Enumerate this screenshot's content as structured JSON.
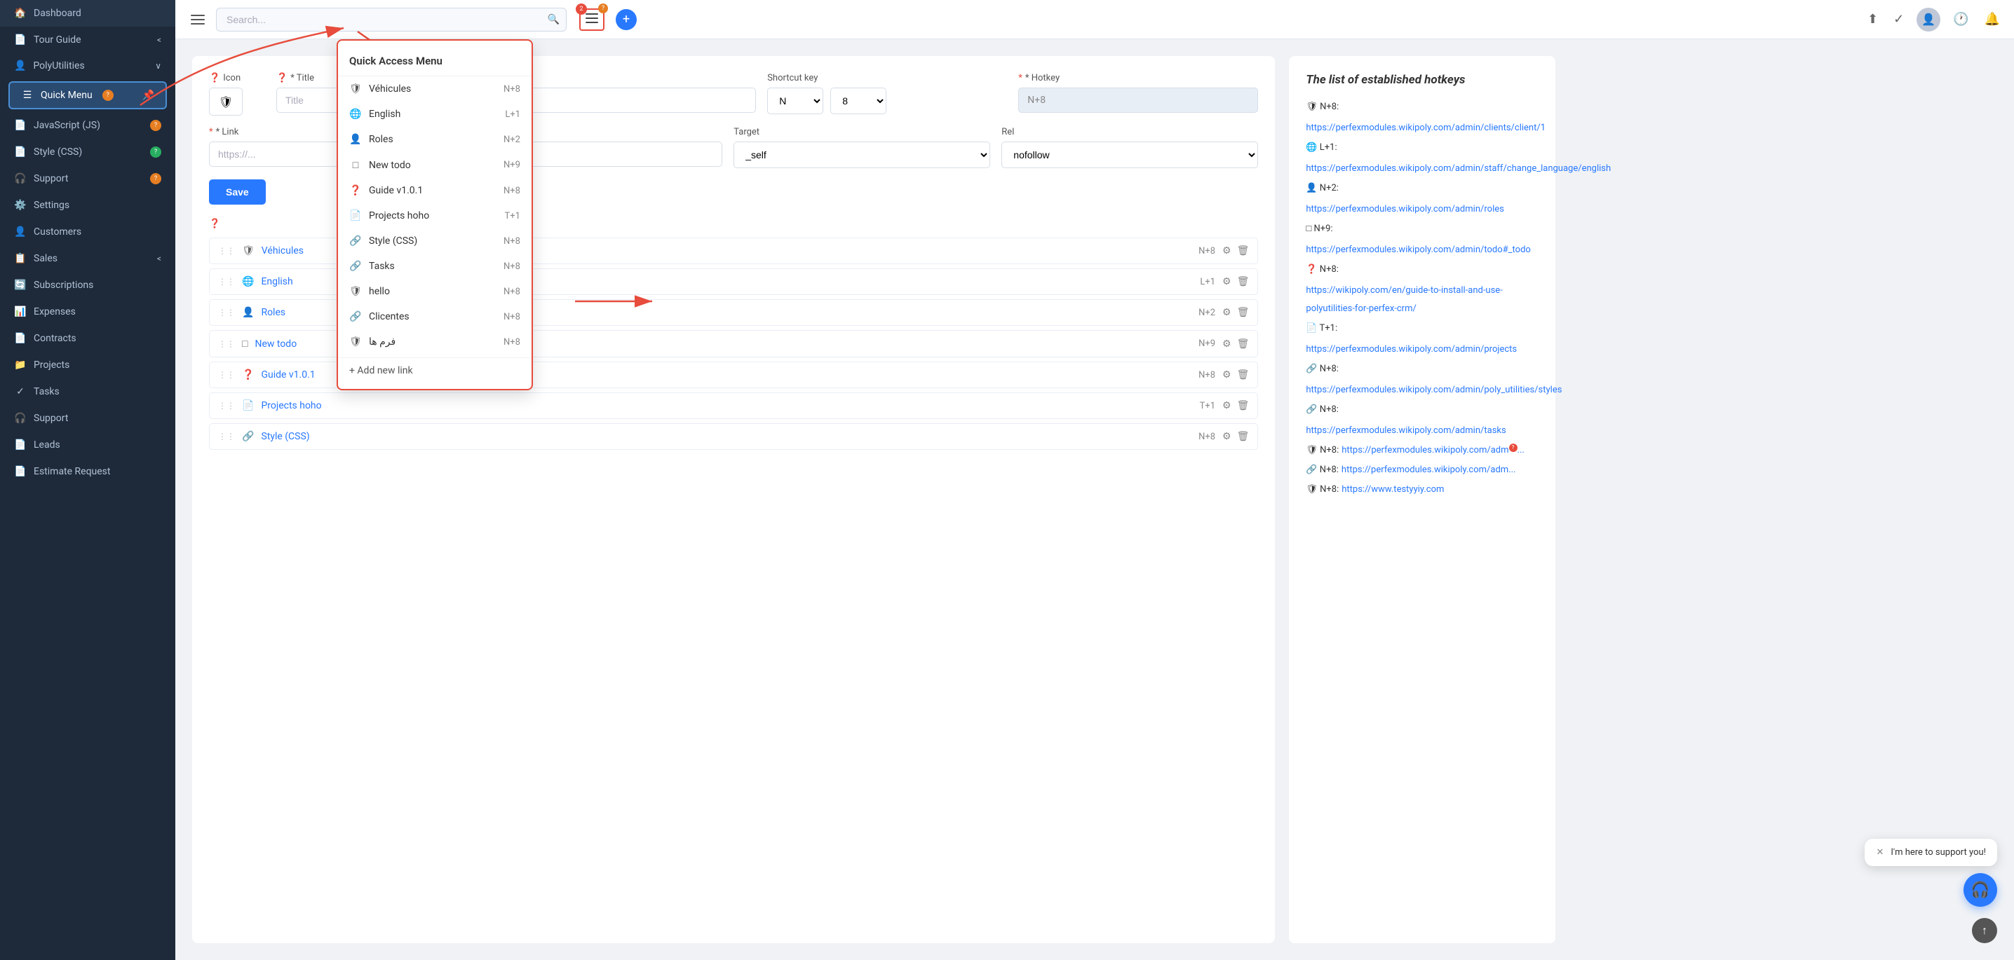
{
  "sidebar": {
    "header": {
      "icon": "🏠",
      "label": "Dashboard"
    },
    "items": [
      {
        "id": "dashboard",
        "icon": "🏠",
        "label": "Dashboard",
        "badge": null
      },
      {
        "id": "tour-guide",
        "icon": "📄",
        "label": "Tour Guide",
        "chevron": "<",
        "badge": null
      },
      {
        "id": "polyutilities",
        "icon": "👤",
        "label": "PolyUtilities",
        "chevron": "∨",
        "badge": null
      },
      {
        "id": "quick-menu",
        "icon": "☰",
        "label": "Quick Menu",
        "active": true,
        "pin": true,
        "helpbadge": true
      },
      {
        "id": "javascript",
        "icon": "📄",
        "label": "JavaScript (JS)",
        "helpbadge": true
      },
      {
        "id": "style-css",
        "icon": "📄",
        "label": "Style (CSS)",
        "helpbadge": true
      },
      {
        "id": "support",
        "icon": "🎧",
        "label": "Support",
        "helpbadge": true
      },
      {
        "id": "settings",
        "icon": "⚙️",
        "label": "Settings"
      },
      {
        "id": "customers",
        "icon": "👤",
        "label": "Customers"
      },
      {
        "id": "sales",
        "icon": "📋",
        "label": "Sales",
        "chevron": "<"
      },
      {
        "id": "subscriptions",
        "icon": "🔄",
        "label": "Subscriptions"
      },
      {
        "id": "expenses",
        "icon": "📊",
        "label": "Expenses"
      },
      {
        "id": "contracts",
        "icon": "📄",
        "label": "Contracts"
      },
      {
        "id": "projects",
        "icon": "📁",
        "label": "Projects"
      },
      {
        "id": "tasks",
        "icon": "✓",
        "label": "Tasks"
      },
      {
        "id": "support2",
        "icon": "🎧",
        "label": "Support"
      },
      {
        "id": "leads",
        "icon": "📄",
        "label": "Leads"
      },
      {
        "id": "estimate-request",
        "icon": "📄",
        "label": "Estimate Request"
      }
    ]
  },
  "topbar": {
    "search_placeholder": "Search...",
    "badge_count": "2",
    "help_count": "?"
  },
  "form": {
    "icon_label": "Icon",
    "title_label": "* Title",
    "title_placeholder": "Title",
    "link_label": "* Link",
    "link_placeholder": "https://...",
    "shortcut_key_label": "Shortcut key",
    "shortcut_n": "N",
    "shortcut_8": "8",
    "hotkey_label": "* Hotkey",
    "hotkey_value": "N+8",
    "target_label": "Target",
    "target_value": "_self",
    "rel_label": "Rel",
    "rel_value": "nofollow",
    "save_label": "Save"
  },
  "quick_access_menu": {
    "title": "Quick Access Menu",
    "items": [
      {
        "icon": "shield",
        "label": "Véhicules",
        "shortcut": "N+8"
      },
      {
        "icon": "globe",
        "label": "English",
        "shortcut": "L+1"
      },
      {
        "icon": "user",
        "label": "Roles",
        "shortcut": "N+2"
      },
      {
        "icon": "square",
        "label": "New todo",
        "shortcut": "N+9"
      },
      {
        "icon": "help",
        "label": "Guide v1.0.1",
        "shortcut": "N+8"
      },
      {
        "icon": "file",
        "label": "Projects hoho",
        "shortcut": "T+1"
      },
      {
        "icon": "link",
        "label": "Style (CSS)",
        "shortcut": "N+8"
      },
      {
        "icon": "link",
        "label": "Tasks",
        "shortcut": "N+8"
      },
      {
        "icon": "shield",
        "label": "hello",
        "shortcut": "N+8"
      },
      {
        "icon": "link",
        "label": "Clicentes",
        "shortcut": "N+8"
      },
      {
        "icon": "shield",
        "label": "فرم ها",
        "shortcut": "N+8"
      }
    ],
    "add_label": "+ Add new link"
  },
  "list_items": [
    {
      "icon": "shield",
      "label": "Véhicules",
      "shortcut": "N+8"
    },
    {
      "icon": "globe",
      "label": "English",
      "shortcut": "L+1"
    },
    {
      "icon": "user",
      "label": "Roles",
      "shortcut": "N+2"
    },
    {
      "icon": "square",
      "label": "New todo",
      "shortcut": "N+9"
    },
    {
      "icon": "help",
      "label": "Guide v1.0.1",
      "shortcut": "N+8"
    },
    {
      "icon": "file",
      "label": "Projects hoho",
      "shortcut": "T+1"
    },
    {
      "icon": "link",
      "label": "Style (CSS)",
      "shortcut": "N+8"
    }
  ],
  "hotkeys_panel": {
    "title": "The list of established hotkeys",
    "items": [
      {
        "prefix": "🛡 N+8:",
        "url": "https://perfexmodules.wikipoly.com/admin/clients/client/1",
        "label": "https://perfexmodules.wikipoly.com/admin/clients/client/1"
      },
      {
        "prefix": "🌐 L+1:",
        "url": "https://perfexmodules.wikipoly.com/admin/staff/change_language/english",
        "label": "https://perfexmodules.wikipoly.com/admin/staff/change_language/english"
      },
      {
        "prefix": "👤 N+2:",
        "url": "https://perfexmodules.wikipoly.com/admin/roles",
        "label": "https://perfexmodules.wikipoly.com/admin/roles"
      },
      {
        "prefix": "□ N+9:",
        "url": "https://perfexmodules.wikipoly.com/admin/todo#_todo",
        "label": "https://perfexmodules.wikipoly.com/admin/todo#_todo"
      },
      {
        "prefix": "❓ N+8:",
        "url": "https://wikipoly.com/en/guide-to-install-and-use-polyutilities-for-perfex-crm/",
        "label": "https://wikipoly.com/en/guide-to-install-and-use-polyutilities-for-perfex-crm/"
      },
      {
        "prefix": "📄 T+1:",
        "url": "https://perfexmodules.wikipoly.com/admin/projects",
        "label": "https://perfexmodules.wikipoly.com/admin/projects"
      },
      {
        "prefix": "🔗 N+8:",
        "url": "https://perfexmodules.wikipoly.com/admin/poly_utilities/styles",
        "label": "https://perfexmodules.wikipoly.com/admin/poly_utilities/styles"
      },
      {
        "prefix": "🔗 N+8:",
        "url": "https://perfexmodules.wikipoly.com/admin/tasks",
        "label": "https://perfexmodules.wikipoly.com/admin/tasks"
      },
      {
        "prefix": "🛡 N+8:",
        "url": "https://perfexmodules.wikipoly.com/admin/...",
        "label": "https://perfexmodules.wikipoly.com/adm..."
      },
      {
        "prefix": "🔗 N+8:",
        "url": "https://perfexmodules.wikipoly.com/adm...",
        "label": "https://perfexmodules.wikipoly.com/adm..."
      },
      {
        "prefix": "🛡 N+8:",
        "url": "https://www.testyyiy.com",
        "label": "https://www.testyyiy.com"
      }
    ]
  },
  "chat": {
    "message": "I'm here to support you!",
    "close_label": "✕"
  }
}
